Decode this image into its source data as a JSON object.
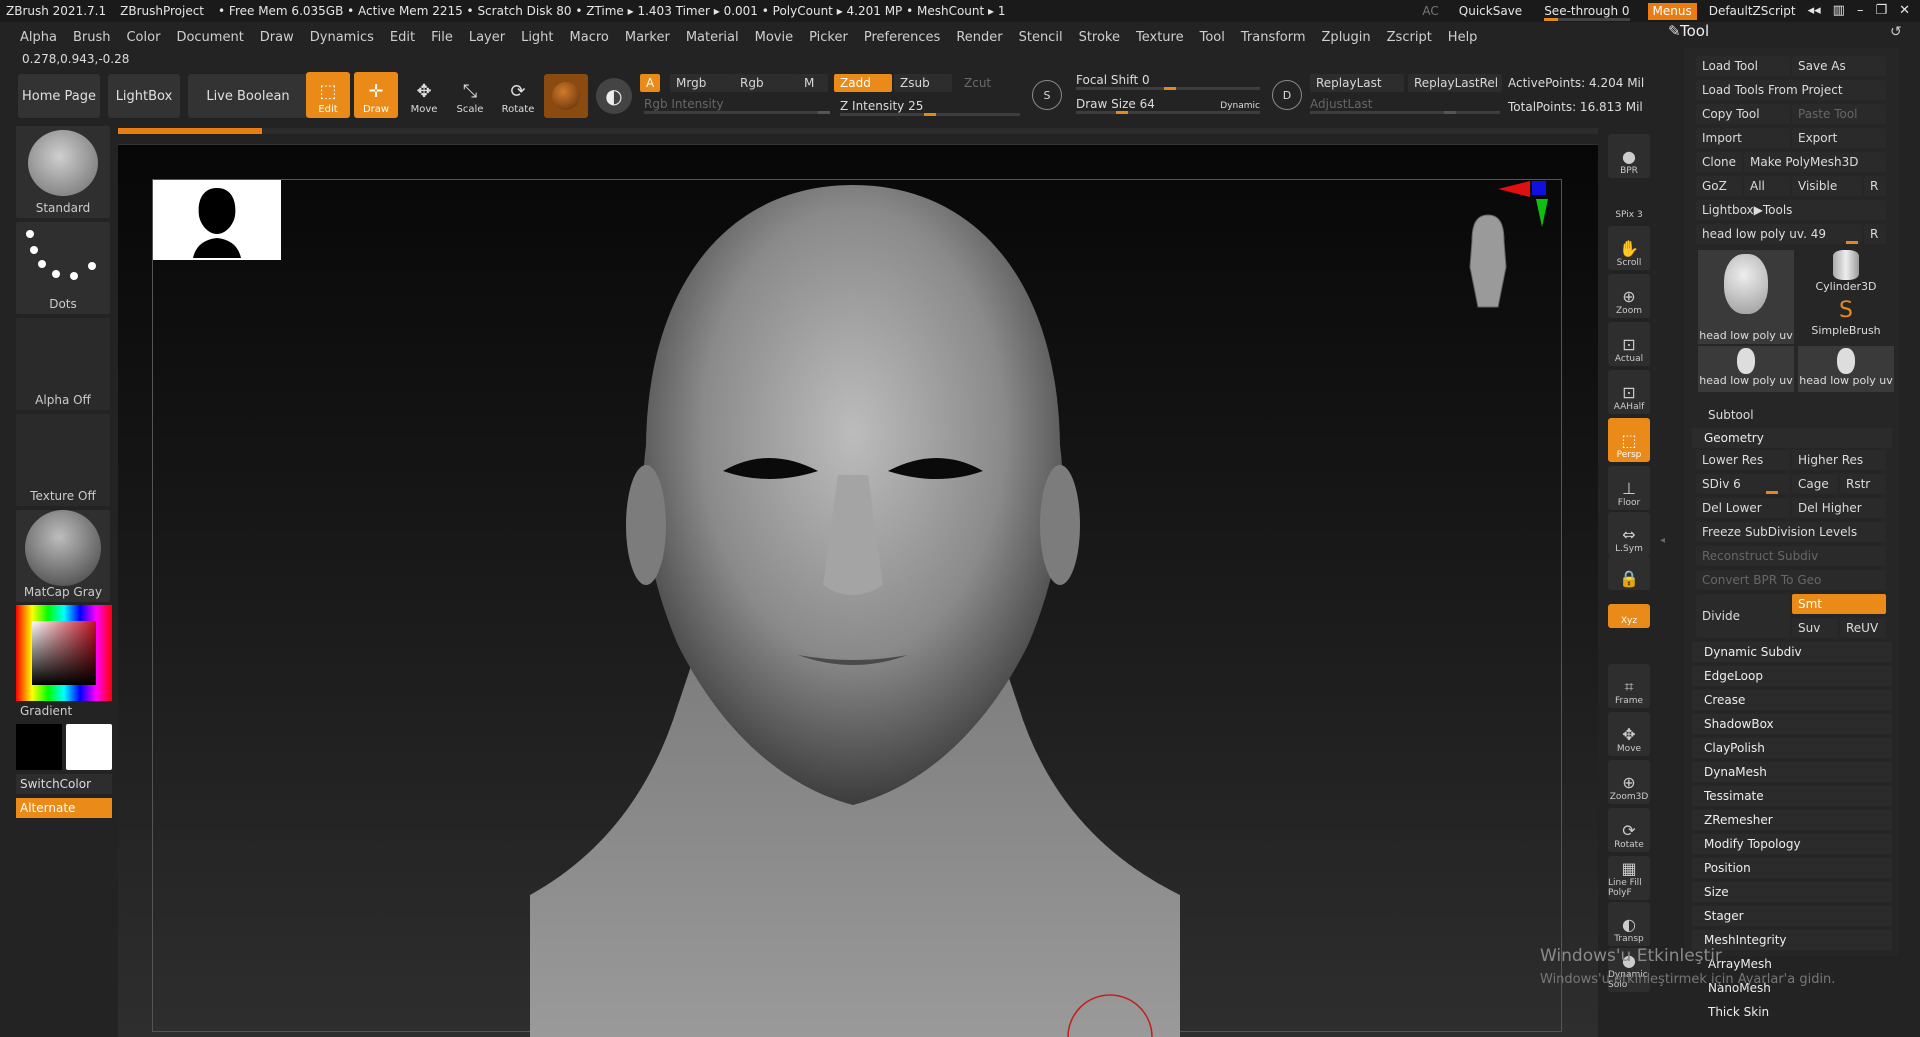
{
  "titlebar": {
    "app": "ZBrush 2021.7.1",
    "project": "ZBrushProject",
    "stats": "• Free Mem 6.035GB • Active Mem 2215 • Scratch Disk 80 • ZTime ▸ 1.403 Timer ▸ 0.001 • PolyCount ▸ 4.201 MP • MeshCount ▸ 1",
    "ac": "AC",
    "quicksave": "QuickSave",
    "seethrough": "See-through  0",
    "menus": "Menus",
    "script": "DefaultZScript"
  },
  "menubar": [
    "Alpha",
    "Brush",
    "Color",
    "Document",
    "Draw",
    "Dynamics",
    "Edit",
    "File",
    "Layer",
    "Light",
    "Macro",
    "Marker",
    "Material",
    "Movie",
    "Picker",
    "Preferences",
    "Render",
    "Stencil",
    "Stroke",
    "Texture",
    "Tool",
    "Transform",
    "Zplugin",
    "Zscript",
    "Help"
  ],
  "coords": "0.278,0.943,-0.28",
  "shelf": {
    "home": "Home Page",
    "lightbox": "LightBox",
    "liveboolean": "Live Boolean",
    "edit": "Edit",
    "draw": "Draw",
    "move": "Move",
    "scale": "Scale",
    "rotate": "Rotate"
  },
  "draw": {
    "a": "A",
    "mrgb": "Mrgb",
    "rgb": "Rgb",
    "m": "M",
    "zadd": "Zadd",
    "zsub": "Zsub",
    "zcut": "Zcut",
    "rgbintensity": "Rgb Intensity",
    "zintensity": "Z Intensity 25",
    "focal": "Focal Shift 0",
    "drawsize": "Draw Size 64",
    "dynamic": "Dynamic",
    "replay": "ReplayLast",
    "replayrel": "ReplayLastRel",
    "adjust": "AdjustLast",
    "activepoints": "ActivePoints: 4.204 Mil",
    "totalpoints": "TotalPoints: 16.813 Mil"
  },
  "leftpanel": {
    "standard": "Standard",
    "dots": "Dots",
    "alpha": "Alpha Off",
    "texture": "Texture Off",
    "matcap": "MatCap Gray",
    "gradient": "Gradient",
    "switchcolor": "SwitchColor",
    "alternate": "Alternate"
  },
  "righttools": [
    {
      "label": "BPR",
      "icon": "bpr-icon"
    },
    {
      "label": "SPix 3",
      "icon": "spix-slider"
    },
    {
      "label": "Scroll",
      "icon": "scroll-icon"
    },
    {
      "label": "Zoom",
      "icon": "zoom-icon"
    },
    {
      "label": "Actual",
      "icon": "actual-icon"
    },
    {
      "label": "AAHalf",
      "icon": "aahalf-icon"
    },
    {
      "label": "Persp",
      "icon": "persp-icon"
    },
    {
      "label": "Floor",
      "icon": "floor-icon"
    },
    {
      "label": "L.Sym",
      "icon": "lsym-icon"
    },
    {
      "label": "",
      "icon": "lock-icon"
    },
    {
      "label": "Xyz",
      "icon": "xyz-icon"
    },
    {
      "label": "Frame",
      "icon": "frame-icon"
    },
    {
      "label": "Move",
      "icon": "move-icon"
    },
    {
      "label": "Zoom3D",
      "icon": "zoom3d-icon"
    },
    {
      "label": "Rotate",
      "icon": "rotate-icon"
    },
    {
      "label": "Line Fill PolyF",
      "icon": "polyf-icon"
    },
    {
      "label": "Transp",
      "icon": "transp-icon"
    },
    {
      "label": "Dynamic Solo",
      "icon": "solo-icon"
    }
  ],
  "tool": {
    "title": "Tool",
    "load": "Load Tool",
    "saveas": "Save As",
    "loadproj": "Load Tools From Project",
    "copy": "Copy Tool",
    "paste": "Paste Tool",
    "import": "Import",
    "export": "Export",
    "clone": "Clone",
    "makepoly": "Make PolyMesh3D",
    "goz": "GoZ",
    "all": "All",
    "visible": "Visible",
    "r": "R",
    "lightboxtools": "Lightbox▶Tools",
    "current": "head low poly uv. 49",
    "thumbs": [
      "head low poly uv",
      "Cylinder3D",
      "SimpleBrush",
      "head low poly uv",
      "head low poly uv"
    ],
    "subtool": "Subtool",
    "geometry": "Geometry",
    "lowerres": "Lower Res",
    "higherres": "Higher Res",
    "sdiv": "SDiv 6",
    "cage": "Cage",
    "rstr": "Rstr",
    "dellower": "Del Lower",
    "delhigher": "Del Higher",
    "freeze": "Freeze SubDivision Levels",
    "reconstruct": "Reconstruct Subdiv",
    "convertbpr": "Convert BPR To Geo",
    "divide": "Divide",
    "smt": "Smt",
    "suv": "Suv",
    "reuv": "ReUV",
    "sections": [
      "Dynamic Subdiv",
      "EdgeLoop",
      "Crease",
      "ShadowBox",
      "ClayPolish",
      "DynaMesh",
      "Tessimate",
      "ZRemesher",
      "Modify Topology",
      "Position",
      "Size",
      "Stager",
      "MeshIntegrity",
      "ArrayMesh",
      "NanoMesh",
      "Thick Skin"
    ]
  },
  "watermark": {
    "line1": "Windows'u Etkinleştir",
    "line2": "Windows'u etkinleştirmek için Ayarlar'a gidin."
  }
}
